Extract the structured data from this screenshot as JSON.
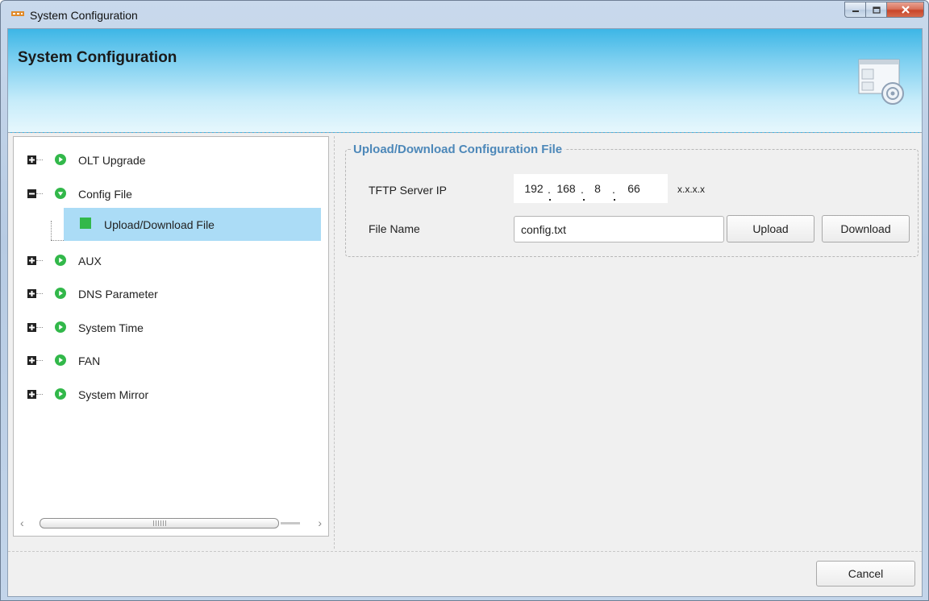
{
  "window": {
    "title": "System Configuration"
  },
  "header": {
    "title": "System Configuration"
  },
  "tree": {
    "items": [
      {
        "label": "OLT Upgrade",
        "expanded": false
      },
      {
        "label": "Config File",
        "expanded": true
      },
      {
        "label": "AUX",
        "expanded": false
      },
      {
        "label": "DNS Parameter",
        "expanded": false
      },
      {
        "label": "System Time",
        "expanded": false
      },
      {
        "label": "FAN",
        "expanded": false
      },
      {
        "label": "System Mirror",
        "expanded": false
      }
    ],
    "selected_child": {
      "label": "Upload/Download File"
    }
  },
  "panel": {
    "group_title": "Upload/Download Configuration File",
    "tftp": {
      "label": "TFTP Server IP",
      "octets": [
        "192",
        "168",
        "8",
        "66"
      ],
      "hint": "x.x.x.x"
    },
    "file": {
      "label": "File Name",
      "value": "config.txt"
    },
    "upload_label": "Upload",
    "download_label": "Download"
  },
  "footer": {
    "cancel_label": "Cancel"
  },
  "colors": {
    "selection": "#abdcf6",
    "status_green": "#32b84a",
    "group_title": "#4d88b9",
    "header_top": "#3db6e6"
  }
}
